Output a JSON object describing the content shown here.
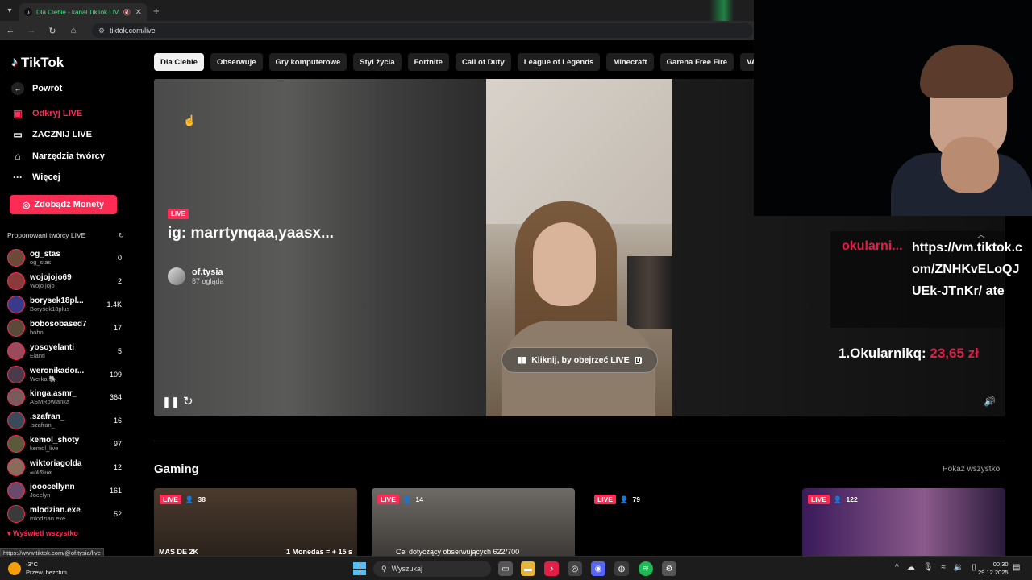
{
  "browser": {
    "tab_title": "Dla Ciebie - kanał TikTok LIVE",
    "url": "tiktok.com/live",
    "status_url": "https://www.tiktok.com/@of.tysia/live"
  },
  "sidebar": {
    "logo": "TikTok",
    "back": "Powrót",
    "nav": [
      {
        "label": "Odkryj LIVE",
        "icon": "tv-icon",
        "active": true
      },
      {
        "label": "ZACZNIJ LIVE",
        "icon": "camera-icon",
        "active": false
      },
      {
        "label": "Narzędzia twórcy",
        "icon": "home-icon",
        "active": false
      },
      {
        "label": "Więcej",
        "icon": "more-icon",
        "active": false
      }
    ],
    "coins_button": "Zdobądź Monety",
    "creators_heading": "Proponowani twórcy LIVE",
    "creators": [
      {
        "name": "og_stas",
        "sub": "og_stas",
        "count": "0",
        "color": "#6b4a3a"
      },
      {
        "name": "wojojojo69",
        "sub": "Wojo jojo",
        "count": "2",
        "color": "#8a3a3a"
      },
      {
        "name": "borysek18pl...",
        "sub": "Borysek18plus",
        "count": "1.4K",
        "color": "#3a3a8a"
      },
      {
        "name": "bobosobased7",
        "sub": "bobo",
        "count": "17",
        "color": "#5a4a3a"
      },
      {
        "name": "yosoyelanti",
        "sub": "Elanti",
        "count": "5",
        "color": "#9a4a5a"
      },
      {
        "name": "weronikador...",
        "sub": "Werka 🐘",
        "count": "109",
        "color": "#4a3a4a"
      },
      {
        "name": "kinga.asmr_",
        "sub": "ASMRowianka",
        "count": "364",
        "color": "#7a5a5a"
      },
      {
        "name": ".szafran_",
        "sub": ".szafran_",
        "count": "16",
        "color": "#3a4a5a"
      },
      {
        "name": "kemol_shoty",
        "sub": "kemol_live",
        "count": "97",
        "color": "#5a5a3a"
      },
      {
        "name": "wiktoriagolda",
        "sub": "𝓌𝒾𝓀𝓉𝑜𝓇𝒾𝒶",
        "count": "12",
        "color": "#8a6a5a"
      },
      {
        "name": "jooocellynn",
        "sub": "Jocelyn",
        "count": "161",
        "color": "#6a4a6a"
      },
      {
        "name": "mlodzian.exe",
        "sub": "mlodzian.exe",
        "count": "52",
        "color": "#3a3a3a"
      }
    ],
    "show_all": "Wyświetl wszystko"
  },
  "categories": [
    "Dla Ciebie",
    "Obserwuje",
    "Gry komputerowe",
    "Styl życia",
    "Fortnite",
    "Call of Duty",
    "League of Legends",
    "Minecraft",
    "Garena Free Fire",
    "VALORANT"
  ],
  "player": {
    "live_label": "LIVE",
    "title": "ig: marrtynqaa,yaasx...",
    "streamer": "of.tysia",
    "viewers": "87 ogląda",
    "watch_label": "Kliknij, by obejrzeć LIVE",
    "watch_key": "D"
  },
  "overlay": {
    "donor": "okularni...",
    "message": "https://vm.tiktok.com/ZNHKvELoQJUEk-JTnKr/ ate",
    "top_label": "1.Okularnikq:",
    "top_amount": "23,65 zł"
  },
  "gaming": {
    "title": "Gaming",
    "show_more": "Pokaż wszystko",
    "cards": [
      {
        "live": "LIVE",
        "viewers": "38",
        "caption": "MAS DE 2K",
        "caption2": "1 Monedas = + 15 s"
      },
      {
        "live": "LIVE",
        "viewers": "14",
        "caption": "Cel dotyczący obserwujących 622/700",
        "caption2": ""
      },
      {
        "live": "LIVE",
        "viewers": "79",
        "caption": "",
        "caption2": ""
      },
      {
        "live": "LIVE",
        "viewers": "122",
        "caption": "",
        "caption2": ""
      }
    ]
  },
  "taskbar": {
    "temperature": "-3°C",
    "weather": "Przew. bezchm.",
    "search_placeholder": "Wyszukaj",
    "time": "00:30",
    "date": "29.12.2025"
  }
}
